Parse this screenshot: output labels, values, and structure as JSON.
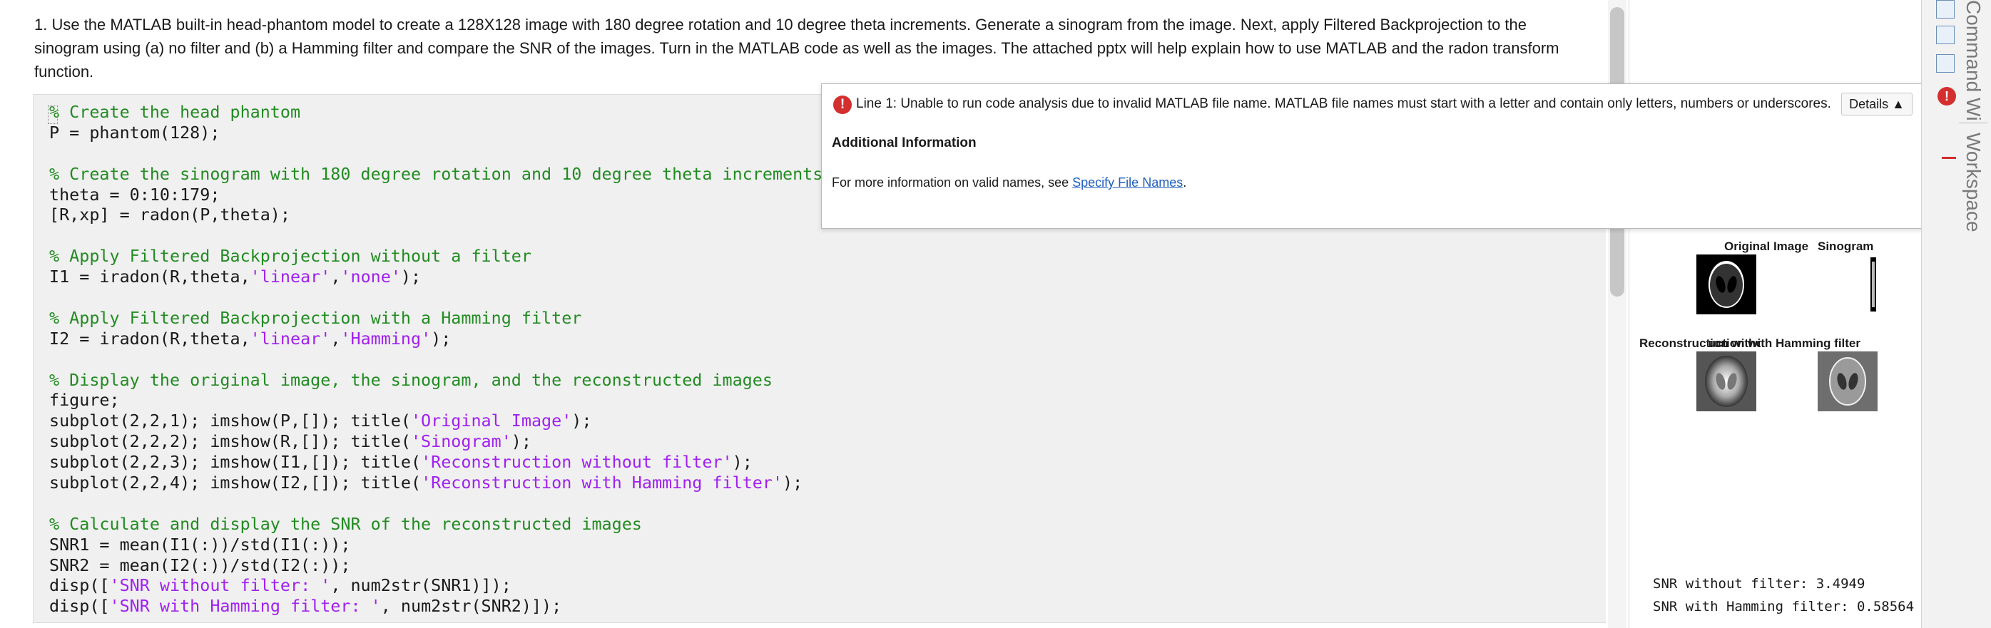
{
  "question": {
    "text": "1. Use the MATLAB built-in head-phantom model to create a 128X128 image with 180 degree rotation and 10 degree theta increments. Generate a sinogram from the image. Next, apply Filtered Backprojection to the sinogram using (a) no filter and (b) a Hamming filter and compare the SNR of the images. Turn in the MATLAB code as well as the images. The attached pptx will help explain how to use MATLAB and the radon transform function."
  },
  "code": {
    "lines": [
      [
        {
          "t": "% Create the head phantom",
          "k": "c"
        }
      ],
      [
        {
          "t": "P = phantom(128);",
          "k": ""
        }
      ],
      [],
      [
        {
          "t": "% Create the sinogram with 180 degree rotation and 10 degree theta increments",
          "k": "c"
        }
      ],
      [
        {
          "t": "theta = 0:10:179;",
          "k": ""
        }
      ],
      [
        {
          "t": "[R,xp] = radon(P,theta);",
          "k": ""
        }
      ],
      [],
      [
        {
          "t": "% Apply Filtered Backprojection without a filter",
          "k": "c"
        }
      ],
      [
        {
          "t": "I1 = iradon(R,theta,",
          "k": ""
        },
        {
          "t": "'linear'",
          "k": "s"
        },
        {
          "t": ",",
          "k": ""
        },
        {
          "t": "'none'",
          "k": "s"
        },
        {
          "t": ");",
          "k": ""
        }
      ],
      [],
      [
        {
          "t": "% Apply Filtered Backprojection with a Hamming filter",
          "k": "c"
        }
      ],
      [
        {
          "t": "I2 = iradon(R,theta,",
          "k": ""
        },
        {
          "t": "'linear'",
          "k": "s"
        },
        {
          "t": ",",
          "k": ""
        },
        {
          "t": "'Hamming'",
          "k": "s"
        },
        {
          "t": ");",
          "k": ""
        }
      ],
      [],
      [
        {
          "t": "% Display the original image, the sinogram, and the reconstructed images",
          "k": "c"
        }
      ],
      [
        {
          "t": "figure;",
          "k": ""
        }
      ],
      [
        {
          "t": "subplot(2,2,1); imshow(P,[]); title(",
          "k": ""
        },
        {
          "t": "'Original Image'",
          "k": "s"
        },
        {
          "t": ");",
          "k": ""
        }
      ],
      [
        {
          "t": "subplot(2,2,2); imshow(R,[]); title(",
          "k": ""
        },
        {
          "t": "'Sinogram'",
          "k": "s"
        },
        {
          "t": ");",
          "k": ""
        }
      ],
      [
        {
          "t": "subplot(2,2,3); imshow(I1,[]); title(",
          "k": ""
        },
        {
          "t": "'Reconstruction without filter'",
          "k": "s"
        },
        {
          "t": ");",
          "k": ""
        }
      ],
      [
        {
          "t": "subplot(2,2,4); imshow(I2,[]); title(",
          "k": ""
        },
        {
          "t": "'Reconstruction with Hamming filter'",
          "k": "s"
        },
        {
          "t": ");",
          "k": ""
        }
      ],
      [],
      [
        {
          "t": "% Calculate and display the SNR of the reconstructed images",
          "k": "c"
        }
      ],
      [
        {
          "t": "SNR1 = mean(I1(:))/std(I1(:));",
          "k": ""
        }
      ],
      [
        {
          "t": "SNR2 = mean(I2(:))/std(I2(:));",
          "k": ""
        }
      ],
      [
        {
          "t": "disp([",
          "k": ""
        },
        {
          "t": "'SNR without filter: '",
          "k": "s"
        },
        {
          "t": ", num2str(SNR1)]);",
          "k": ""
        }
      ],
      [
        {
          "t": "disp([",
          "k": ""
        },
        {
          "t": "'SNR with Hamming filter: '",
          "k": "s"
        },
        {
          "t": ", num2str(SNR2)]);",
          "k": ""
        }
      ]
    ]
  },
  "popup": {
    "error_message": "Line 1: Unable to run code analysis due to invalid MATLAB file name. MATLAB file names must start with a letter and contain only letters, numbers or underscores.",
    "details_label": "Details",
    "details_arrow": "▲",
    "error_glyph": "!",
    "additional_heading": "Additional Information",
    "info_prefix": "For more information on valid names, see ",
    "info_link": "Specify File Names",
    "info_suffix": "."
  },
  "figure": {
    "titles": {
      "original": "Original Image",
      "sinogram": "Sinogram",
      "recon_none": "Reconstruction without filter",
      "recon_hamming": "Reconstruction with Hamming filter"
    }
  },
  "output": {
    "line1": "SNR without filter: 3.4949",
    "line2": "SNR with Hamming filter: 0.58564"
  },
  "side_tabs": {
    "command_window": "Command Window",
    "workspace": "Workspace",
    "error_glyph": "!"
  },
  "icons": [
    "error-icon",
    "details-arrow-icon",
    "toolbar-icon"
  ],
  "colors": {
    "comment": "#228b22",
    "string": "#a020f0",
    "error": "#d32f2f",
    "link": "#1f5fbf",
    "editor_bg": "#f0f0f0"
  }
}
